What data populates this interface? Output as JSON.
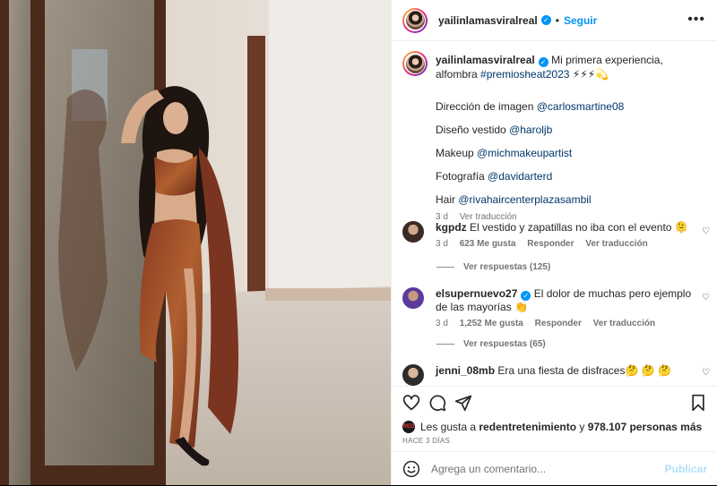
{
  "post": {
    "username": "yailinlamasviralreal",
    "follow_label": "Seguir",
    "more_label": "•••",
    "verified_mark": "✓",
    "photo_alt": "Foto de la publicación"
  },
  "caption": {
    "username": "yailinlamasviralreal",
    "text": "Mi primera experiencia, alfombra",
    "hashtag": "#premiosheat2023",
    "emojis": "⚡⚡⚡💫",
    "credits": [
      {
        "label": "Dirección de imagen",
        "handle": "@carlosmartine08"
      },
      {
        "label": "Diseño vestido",
        "handle": "@haroljb"
      },
      {
        "label": "Makeup",
        "handle": "@michmakeupartist"
      },
      {
        "label": "Fotografía",
        "handle": "@davidarterd"
      },
      {
        "label": "Hair",
        "handle": "@rivahaircenterplazasambil"
      }
    ],
    "time": "3 d",
    "translate_label": "Ver traducción"
  },
  "comments": [
    {
      "username": "kgpdz",
      "text": "El vestido y zapatillas no iba con el evento 🫠",
      "time": "3 d",
      "likes": "623 Me gusta",
      "reply_label": "Responder",
      "translate_label": "Ver traducción",
      "replies_label": "Ver respuestas (125)"
    },
    {
      "username": "elsupernuevo27",
      "text": "El dolor de muchas pero ejemplo de las mayorías 👏",
      "time": "3 d",
      "likes": "1,252 Me gusta",
      "reply_label": "Responder",
      "translate_label": "Ver traducción",
      "replies_label": "Ver respuestas (65)"
    },
    {
      "username": "jenni_08mb",
      "text": "Era una fiesta de disfraces🤔 🤔 🤔"
    }
  ],
  "footer": {
    "likes_prefix": "Les gusta a",
    "likes_user": "redentretenimiento",
    "likes_middle": "y",
    "likes_count": "978.107 personas más",
    "mini_avatar_text": "RED",
    "time_ago": "HACE 3 DÍAS",
    "comment_placeholder": "Agrega un comentario...",
    "publish_label": "Publicar"
  },
  "colors": {
    "accent": "#0095f6",
    "tag": "#00376b",
    "muted": "#737373",
    "publish_disabled": "#b2dffc"
  }
}
